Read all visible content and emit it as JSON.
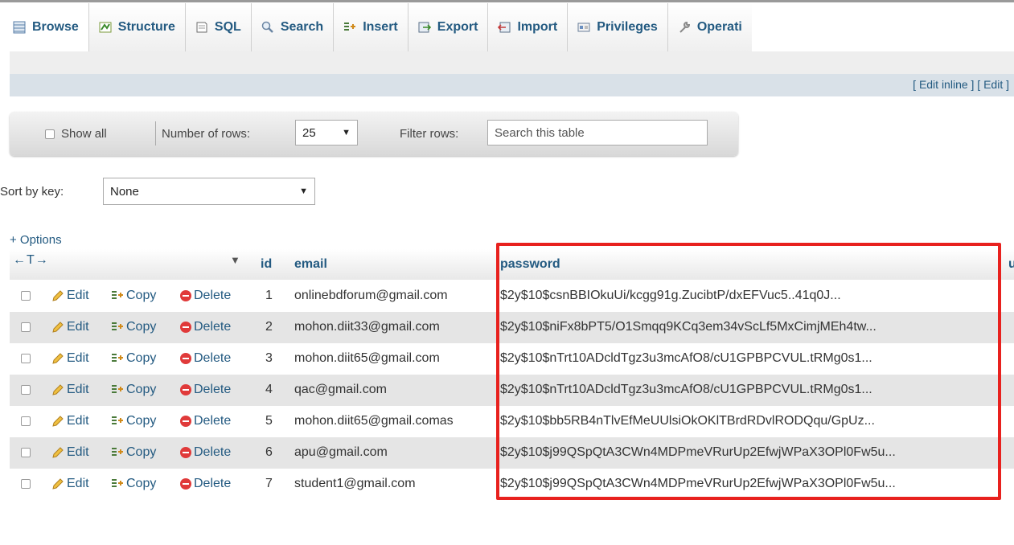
{
  "tabs": [
    {
      "label": "Browse",
      "icon": "browse-icon"
    },
    {
      "label": "Structure",
      "icon": "structure-icon"
    },
    {
      "label": "SQL",
      "icon": "sql-icon"
    },
    {
      "label": "Search",
      "icon": "search-icon"
    },
    {
      "label": "Insert",
      "icon": "insert-icon"
    },
    {
      "label": "Export",
      "icon": "export-icon"
    },
    {
      "label": "Import",
      "icon": "import-icon"
    },
    {
      "label": "Privileges",
      "icon": "privileges-icon"
    },
    {
      "label": "Operati",
      "icon": "wrench-icon"
    }
  ],
  "edit_bar": {
    "open1": "[ ",
    "edit_inline": "Edit inline",
    "mid": " ] [ ",
    "edit": "Edit",
    "close": " ]"
  },
  "nav": {
    "show_all": "Show all",
    "number_of_rows_label": "Number of rows:",
    "rows_value": "25",
    "filter_label": "Filter rows:",
    "search_placeholder": "Search this table"
  },
  "sort": {
    "label": "Sort by key:",
    "value": "None"
  },
  "options_link": "+ Options",
  "column_arrows": "←T→",
  "columns": {
    "id": "id",
    "email": "email",
    "password": "password",
    "next": "u"
  },
  "row_actions": {
    "edit": "Edit",
    "copy": "Copy",
    "delete": "Delete"
  },
  "rows": [
    {
      "id": "1",
      "email": "onlinebdforum@gmail.com",
      "password": "$2y$10$csnBBIOkuUi/kcgg91g.ZucibtP/dxEFVuc5..41q0J..."
    },
    {
      "id": "2",
      "email": "mohon.diit33@gmail.com",
      "password": "$2y$10$niFx8bPT5/O1Smqq9KCq3em34vScLf5MxCimjMEh4tw..."
    },
    {
      "id": "3",
      "email": "mohon.diit65@gmail.com",
      "password": "$2y$10$nTrt10ADcldTgz3u3mcAfO8/cU1GPBPCVUL.tRMg0s1..."
    },
    {
      "id": "4",
      "email": "qac@gmail.com",
      "password": "$2y$10$nTrt10ADcldTgz3u3mcAfO8/cU1GPBPCVUL.tRMg0s1..."
    },
    {
      "id": "5",
      "email": "mohon.diit65@gmail.comas",
      "password": "$2y$10$bb5RB4nTlvEfMeUUlsiOkOKlTBrdRDvlRODQqu/GpUz..."
    },
    {
      "id": "6",
      "email": "apu@gmail.com",
      "password": "$2y$10$j99QSpQtA3CWn4MDPmeVRurUp2EfwjWPaX3OPl0Fw5u..."
    },
    {
      "id": "7",
      "email": "student1@gmail.com",
      "password": "$2y$10$j99QSpQtA3CWn4MDPmeVRurUp2EfwjWPaX3OPl0Fw5u..."
    }
  ],
  "colors": {
    "link": "#235a81",
    "highlight": "#e8211e",
    "row_even": "#e5e5e5",
    "edit_bar": "#d9e1e8"
  }
}
